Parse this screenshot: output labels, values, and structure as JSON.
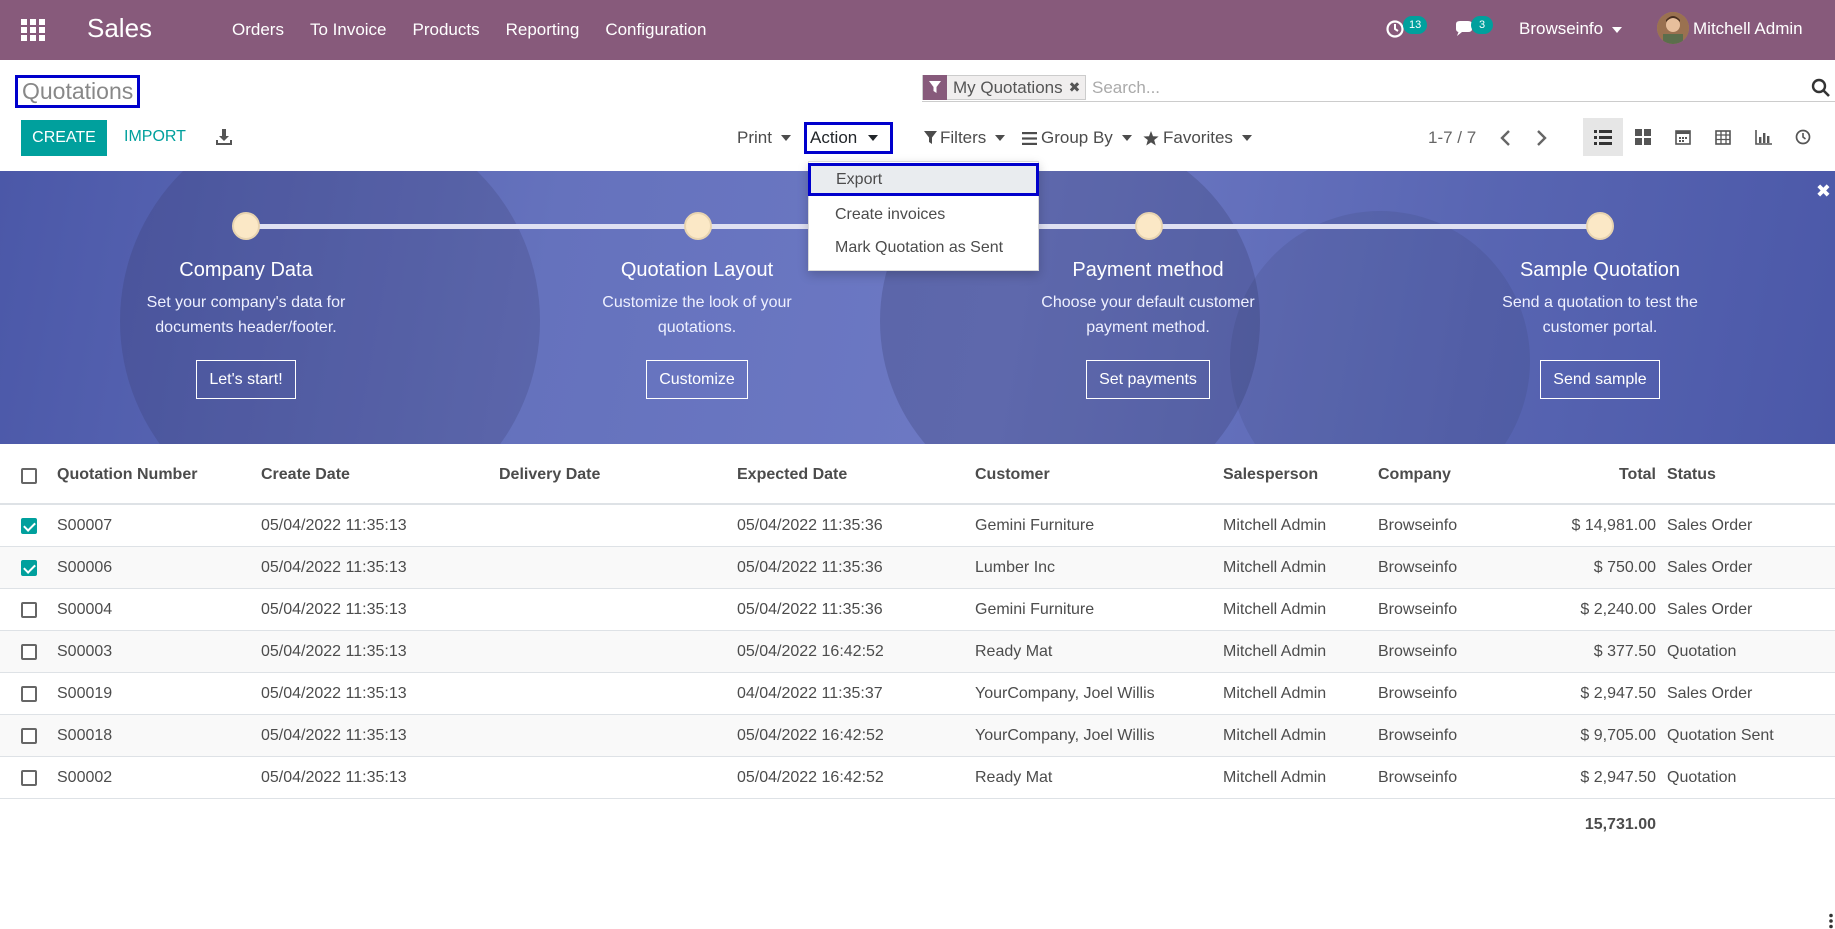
{
  "navbar": {
    "app_name": "Sales",
    "menu": [
      "Orders",
      "To Invoice",
      "Products",
      "Reporting",
      "Configuration"
    ],
    "activity_count": "13",
    "message_count": "3",
    "company": "Browseinfo",
    "user": "Mitchell Admin",
    "color": "#875a7b"
  },
  "control_panel": {
    "breadcrumb": "Quotations",
    "search": {
      "facet": "My Quotations",
      "placeholder": "Search..."
    },
    "create_label": "CREATE",
    "import_label": "IMPORT",
    "print_label": "Print",
    "action_label": "Action",
    "filters_label": "Filters",
    "groupby_label": "Group By",
    "favorites_label": "Favorites",
    "pager": "1-7 / 7",
    "accent": "#00a09d"
  },
  "action_menu": {
    "items": [
      "Export",
      "Create invoices",
      "Mark Quotation as Sent"
    ]
  },
  "onboarding": {
    "steps": [
      {
        "title": "Company Data",
        "desc1": "Set your company's data for",
        "desc2": "documents header/footer.",
        "button": "Let's start!"
      },
      {
        "title": "Quotation Layout",
        "desc1": "Customize the look of your",
        "desc2": "quotations.",
        "button": "Customize"
      },
      {
        "title": "Payment method",
        "desc1": "Choose your default customer",
        "desc2": "payment method.",
        "button": "Set payments"
      },
      {
        "title": "Sample Quotation",
        "desc1": "Send a quotation to test the",
        "desc2": "customer portal.",
        "button": "Send sample"
      }
    ]
  },
  "table": {
    "headers": [
      "Quotation Number",
      "Create Date",
      "Delivery Date",
      "Expected Date",
      "Customer",
      "Salesperson",
      "Company",
      "Total",
      "Status"
    ],
    "rows": [
      {
        "selected": true,
        "number": "S00007",
        "create": "05/04/2022 11:35:13",
        "delivery": "",
        "expected": "05/04/2022 11:35:36",
        "customer": "Gemini Furniture",
        "salesperson": "Mitchell Admin",
        "company": "Browseinfo",
        "total": "$ 14,981.00",
        "status": "Sales Order"
      },
      {
        "selected": true,
        "number": "S00006",
        "create": "05/04/2022 11:35:13",
        "delivery": "",
        "expected": "05/04/2022 11:35:36",
        "customer": "Lumber Inc",
        "salesperson": "Mitchell Admin",
        "company": "Browseinfo",
        "total": "$ 750.00",
        "status": "Sales Order"
      },
      {
        "selected": false,
        "number": "S00004",
        "create": "05/04/2022 11:35:13",
        "delivery": "",
        "expected": "05/04/2022 11:35:36",
        "customer": "Gemini Furniture",
        "salesperson": "Mitchell Admin",
        "company": "Browseinfo",
        "total": "$ 2,240.00",
        "status": "Sales Order"
      },
      {
        "selected": false,
        "number": "S00003",
        "create": "05/04/2022 11:35:13",
        "delivery": "",
        "expected": "05/04/2022 16:42:52",
        "customer": "Ready Mat",
        "salesperson": "Mitchell Admin",
        "company": "Browseinfo",
        "total": "$ 377.50",
        "status": "Quotation"
      },
      {
        "selected": false,
        "number": "S00019",
        "create": "05/04/2022 11:35:13",
        "delivery": "",
        "expected": "04/04/2022 11:35:37",
        "customer": "YourCompany, Joel Willis",
        "salesperson": "Mitchell Admin",
        "company": "Browseinfo",
        "total": "$ 2,947.50",
        "status": "Sales Order"
      },
      {
        "selected": false,
        "number": "S00018",
        "create": "05/04/2022 11:35:13",
        "delivery": "",
        "expected": "05/04/2022 16:42:52",
        "customer": "YourCompany, Joel Willis",
        "salesperson": "Mitchell Admin",
        "company": "Browseinfo",
        "total": "$ 9,705.00",
        "status": "Quotation Sent"
      },
      {
        "selected": false,
        "number": "S00002",
        "create": "05/04/2022 11:35:13",
        "delivery": "",
        "expected": "05/04/2022 16:42:52",
        "customer": "Ready Mat",
        "salesperson": "Mitchell Admin",
        "company": "Browseinfo",
        "total": "$ 2,947.50",
        "status": "Quotation"
      }
    ],
    "total_sum": "15,731.00"
  }
}
